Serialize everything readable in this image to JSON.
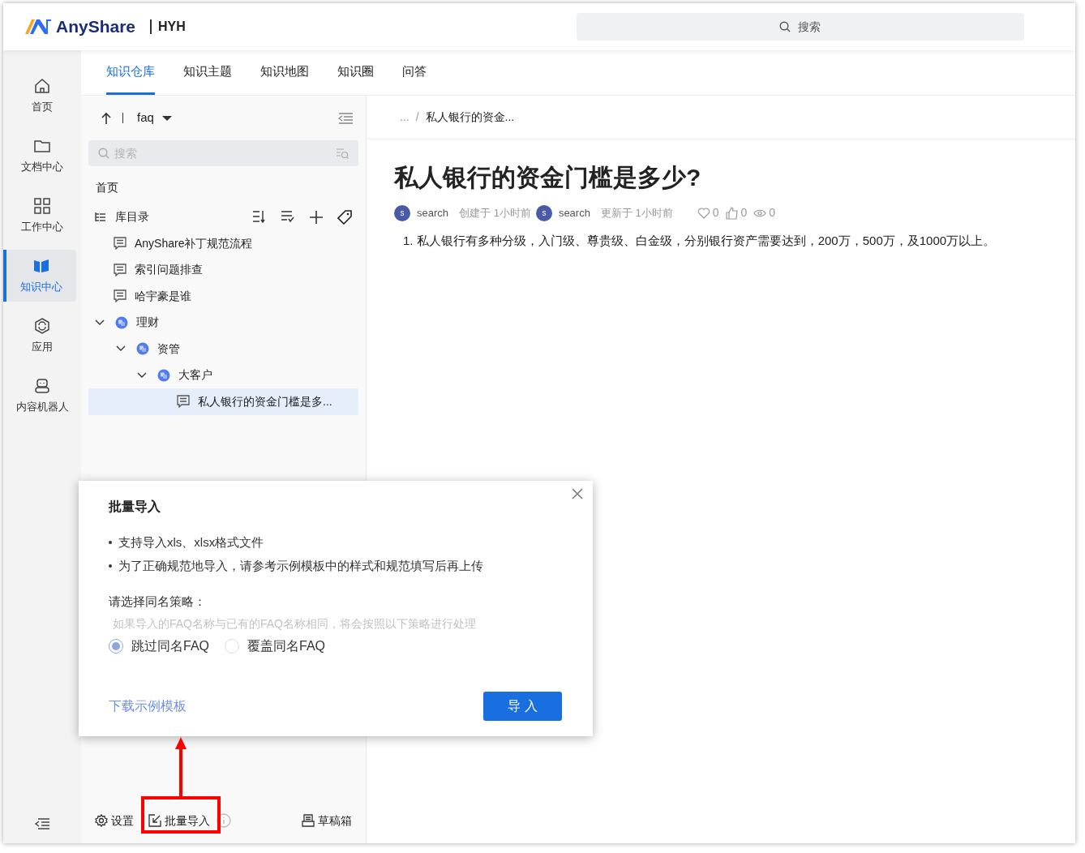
{
  "header": {
    "logo_text": "AnyShare",
    "workspace": "HYH",
    "search": {
      "placeholder": "搜索"
    }
  },
  "nav": [
    {
      "label": "首页",
      "kind": "home",
      "selected": false
    },
    {
      "label": "文档中心",
      "kind": "folder",
      "selected": false
    },
    {
      "label": "工作中心",
      "kind": "grid",
      "selected": false
    },
    {
      "label": "知识中心",
      "kind": "book",
      "selected": true
    },
    {
      "label": "应用",
      "kind": "app",
      "selected": false
    },
    {
      "label": "内容机器人",
      "kind": "robot",
      "selected": false
    }
  ],
  "tabs": [
    {
      "label": "知识仓库",
      "selected": true
    },
    {
      "label": "知识主题",
      "selected": false
    },
    {
      "label": "知识地图",
      "selected": false
    },
    {
      "label": "知识圈",
      "selected": false
    },
    {
      "label": "问答",
      "selected": false
    }
  ],
  "tree_panel": {
    "library": "faq",
    "search": {
      "placeholder": "搜索"
    },
    "home": "首页",
    "root": {
      "label": "库目录",
      "children": [
        {
          "kind": "doc",
          "label": "AnyShare补丁规范流程",
          "selected": false
        },
        {
          "kind": "doc",
          "label": "索引问题排查",
          "selected": false
        },
        {
          "kind": "doc",
          "label": "哈宇豪是谁",
          "selected": false
        },
        {
          "kind": "folder",
          "label": "理财",
          "expanded": true,
          "selected": false,
          "children": [
            {
              "kind": "folder",
              "label": "资管",
              "expanded": true,
              "selected": false,
              "children": [
                {
                  "kind": "folder",
                  "label": "大客户",
                  "expanded": true,
                  "selected": false,
                  "children": [
                    {
                      "kind": "doc",
                      "label": "私人银行的资金门槛是多...",
                      "selected": true
                    }
                  ]
                }
              ]
            }
          ]
        }
      ]
    },
    "footer": {
      "settings": "设置",
      "import": "批量导入",
      "drafts": "草稿箱"
    }
  },
  "document": {
    "breadcrumb": [
      "...",
      "/",
      "私人银行的资金..."
    ],
    "title": "私人银行的资金门槛是多少?",
    "meta": {
      "creator_avatar": "s",
      "creator": "search",
      "created": "创建于 1小时前",
      "updater_avatar": "s",
      "updater": "search",
      "updated": "更新于 1小时前",
      "likes": "0",
      "thumbs": "0",
      "views": "0"
    },
    "body": "1. 私人银行有多种分级，入门级、尊贵级、白金级，分别银行资产需要达到，200万，500万，及1000万以上。"
  },
  "import_popup": {
    "title": "批量导入",
    "notes": [
      "支持导入xls、xlsx格式文件",
      "为了正确规范地导入，请参考示例模板中的样式和规范填写后再上传"
    ],
    "strategy_label": "请选择同名策略：",
    "strategy_hint": "如果导入的FAQ名称与已有的FAQ名称相同，将会按照以下策略进行处理",
    "options": [
      {
        "label": "跳过同名FAQ",
        "selected": true
      },
      {
        "label": "覆盖同名FAQ",
        "selected": false
      }
    ],
    "template_link": "下载示例模板",
    "import_button": "导 入"
  }
}
